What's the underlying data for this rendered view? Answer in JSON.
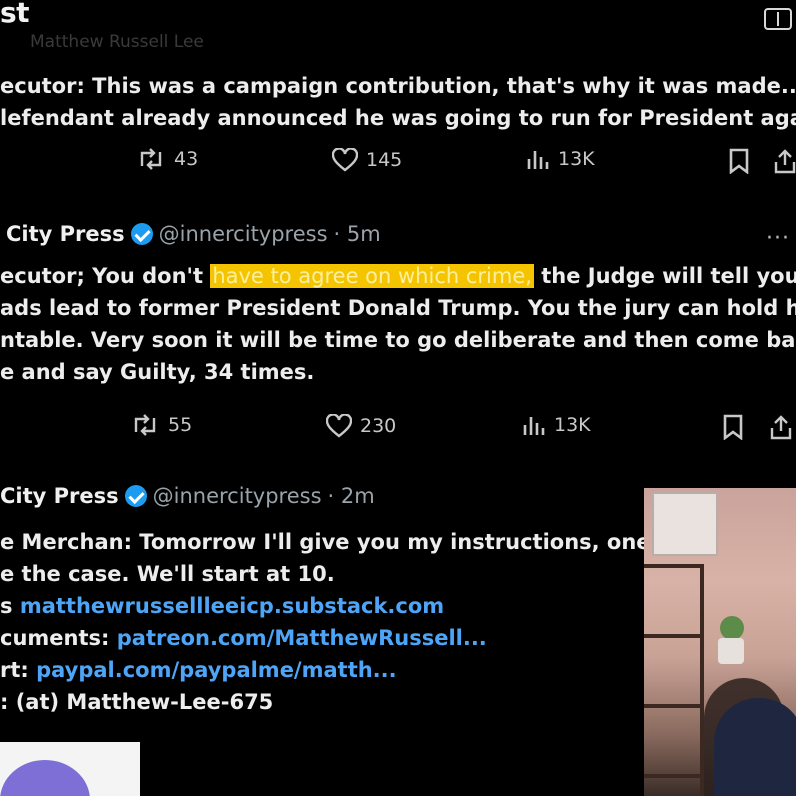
{
  "header": {
    "title": "st"
  },
  "tweet1": {
    "faint_text": "Matthew Russell Lee",
    "lines": [
      "ecutor: This was a campaign contribution, that's why it was made...",
      "lefendant already announced he was going to run for President again."
    ],
    "retweets": "43",
    "likes": "145",
    "views": "13K"
  },
  "tweet2": {
    "name": "City Press",
    "handle": "@innercitypress",
    "time": "· 5m",
    "more": "···",
    "line1_pre": "ecutor; You don't ",
    "line1_highlight": "have to agree on which crime,",
    "line1_post": " the Judge will tell you.",
    "lines": [
      "ads lead to former President Donald Trump. You the jury can hold him",
      "ntable. Very soon it will be time to go deliberate and then come back",
      "e and say Guilty, 34 times."
    ],
    "retweets": "55",
    "likes": "230",
    "views": "13K"
  },
  "tweet3": {
    "name": "City Press",
    "handle": "@innercitypress",
    "time": "· 2m",
    "lines": [
      "e Merchan: Tomorrow I'll give you my instructions, one h",
      "e the case.  We'll start at 10."
    ],
    "link1_prefix": "s ",
    "link1": "matthewrussellleeicp.substack.com",
    "link2_prefix": "cuments: ",
    "link2": "patreon.com/MatthewRussell...",
    "link3_prefix": "rt: ",
    "link3": "paypal.com/paypalme/matth...",
    "last_line": ":  (at) Matthew-Lee-675"
  },
  "colors": {
    "accent": "#1d9bf0",
    "highlight": "#f5c400",
    "link": "#4ea4f7"
  },
  "icons": [
    "book-open-icon",
    "retweet-icon",
    "heart-icon",
    "views-icon",
    "bookmark-icon",
    "share-icon",
    "verified-badge-icon",
    "more-icon"
  ]
}
